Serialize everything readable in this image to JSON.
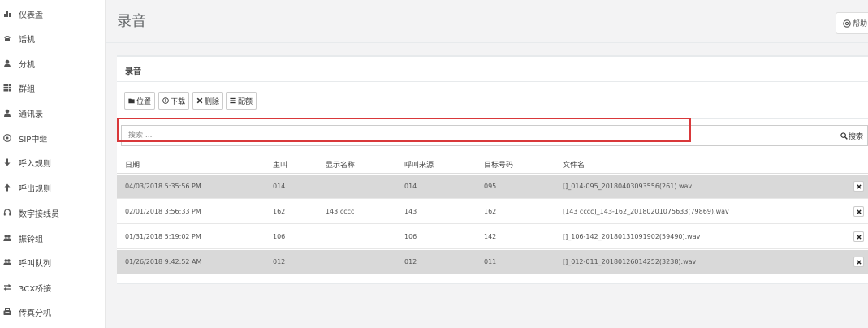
{
  "sidebar": {
    "items": [
      {
        "label": "仪表盘",
        "icon": "bar-chart-icon"
      },
      {
        "label": "话机",
        "icon": "phone-icon"
      },
      {
        "label": "分机",
        "icon": "user-icon"
      },
      {
        "label": "群组",
        "icon": "grid-icon"
      },
      {
        "label": "通讯录",
        "icon": "user-icon"
      },
      {
        "label": "SIP中继",
        "icon": "globe-icon"
      },
      {
        "label": "呼入规则",
        "icon": "arrow-down-icon"
      },
      {
        "label": "呼出规则",
        "icon": "arrow-up-icon"
      },
      {
        "label": "数字接线员",
        "icon": "headset-icon"
      },
      {
        "label": "振铃组",
        "icon": "users-icon"
      },
      {
        "label": "呼叫队列",
        "icon": "users-icon"
      },
      {
        "label": "3CX桥接",
        "icon": "exchange-icon"
      },
      {
        "label": "传真分机",
        "icon": "fax-icon"
      }
    ]
  },
  "header": {
    "title": "录音",
    "help_label": "帮助"
  },
  "panel": {
    "title": "录音",
    "toolbar": {
      "location": "位置",
      "download": "下载",
      "delete": "删除",
      "config": "配额"
    },
    "search": {
      "placeholder": "搜索 ...",
      "button": "搜索"
    },
    "columns": [
      "日期",
      "主叫",
      "显示名称",
      "呼叫来源",
      "目标号码",
      "文件名"
    ],
    "rows": [
      {
        "date": "04/03/2018 5:35:56 PM",
        "caller": "014",
        "display_name": "",
        "source": "014",
        "target": "095",
        "file": "[]_014-095_20180403093556(261).wav",
        "highlighted": true
      },
      {
        "date": "02/01/2018 3:56:33 PM",
        "caller": "162",
        "display_name": "143 cccc",
        "source": "143",
        "target": "162",
        "file": "[143 cccc]_143-162_20180201075633(79869).wav",
        "highlighted": false
      },
      {
        "date": "01/31/2018 5:19:02 PM",
        "caller": "106",
        "display_name": "",
        "source": "106",
        "target": "142",
        "file": "[]_106-142_20180131091902(59490).wav",
        "highlighted": false
      },
      {
        "date": "01/26/2018 9:42:52 AM",
        "caller": "012",
        "display_name": "",
        "source": "012",
        "target": "011",
        "file": "[]_012-011_20180126014252(3238).wav",
        "highlighted": false
      }
    ]
  },
  "colors": {
    "highlight_border": "#d9383a",
    "row_gray": "#d9d9d9"
  }
}
